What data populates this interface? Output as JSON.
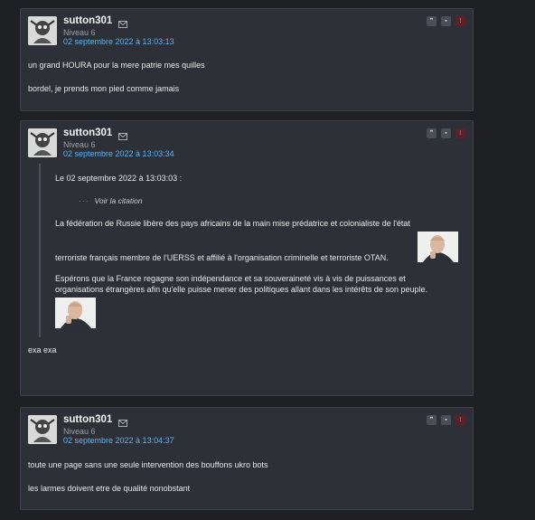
{
  "posts": [
    {
      "author": "sutton301",
      "level": "Niveau 6",
      "date": "02 septembre 2022 à 13:03:13",
      "paragraphs": [
        "un grand HOURA pour la mere patrie mes quilles",
        "bordel, je prends mon pied comme jamais"
      ]
    },
    {
      "author": "sutton301",
      "level": "Niveau 6",
      "date": "02 septembre 2022 à 13:03:34",
      "quote": {
        "header": "Le 02 septembre 2022 à 13:03:03 :",
        "see_quote": "Voir la citation",
        "para1": "La fédération de Russie libère des pays africains de la main mise prédatrice et colonialiste de l'état",
        "para1_cont": "terroriste français membre de l'UERSS et affilié à l'organisation criminelle et terroriste OTAN.",
        "para2_line1": "Espérons que la France regagne son indépendance et sa souveraineté vis à vis de puissances et",
        "para2_line2": "organisations étrangères afin qu'elle puisse mener des politiques allant dans les intérêts de son peuple."
      },
      "reply": "exa exa"
    },
    {
      "author": "sutton301",
      "level": "Niveau 6",
      "date": "02 septembre 2022 à 13:04:37",
      "paragraphs": [
        "toute une page sans une seule intervention des bouffons ukro bots",
        "les larmes doivent etre de qualité nonobstant"
      ]
    }
  ],
  "icons": {
    "mail": "envelope-icon",
    "quote": "quote-button",
    "mp": "bookmark-button",
    "report": "report-button"
  },
  "colors": {
    "accent_date": "#5fb1f0",
    "report": "#ff4a4a"
  }
}
